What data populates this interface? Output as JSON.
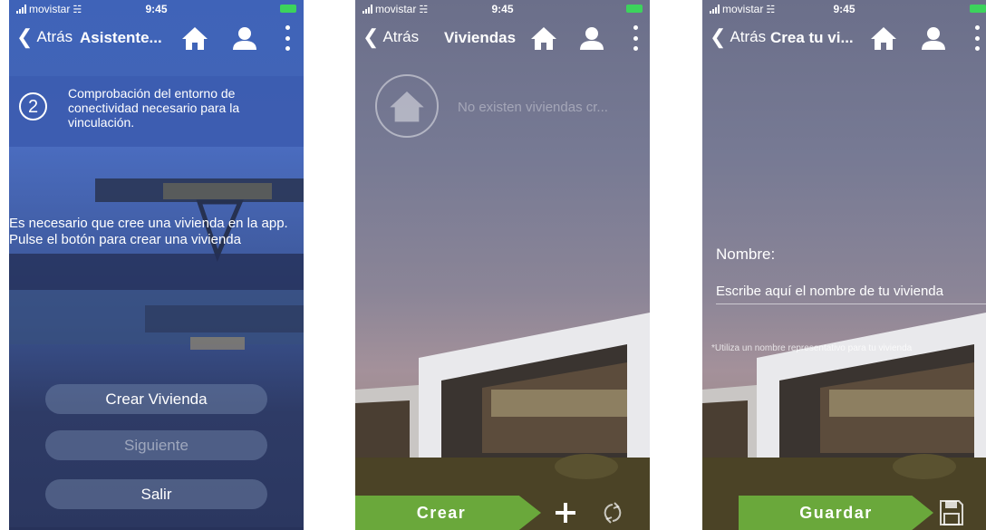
{
  "status_bar": {
    "carrier": "movistar",
    "time": "9:45"
  },
  "screen1": {
    "back_label": "Atrás",
    "title": "Asistente...",
    "step_number": "2",
    "step_text": "Comprobación del entorno de conectividad necesario para la vinculación.",
    "message": "Es necesario que cree una vivienda en la app. Pulse el botón para crear una vivienda",
    "buttons": {
      "create": "Crear Vivienda",
      "next": "Siguiente",
      "exit": "Salir"
    },
    "icons": [
      "home-icon",
      "user-icon",
      "more-vertical-icon"
    ]
  },
  "screen2": {
    "back_label": "Atrás",
    "title": "Viviendas",
    "empty_text": "No existen viviendas cr...",
    "create_button": "Crear",
    "icons": [
      "home-icon",
      "user-icon",
      "more-vertical-icon",
      "plus-icon",
      "refresh-icon"
    ]
  },
  "screen3": {
    "back_label": "Atrás",
    "title": "Crea tu vi...",
    "name_label": "Nombre:",
    "name_placeholder": "Escribe aquí el nombre de tu vivienda",
    "hint": "*Utiliza un nombre representativo para tu vivienda",
    "save_button": "Guardar",
    "icons": [
      "home-icon",
      "user-icon",
      "more-vertical-icon",
      "save-icon"
    ]
  },
  "colors": {
    "accent_green": "#6aa83b",
    "screen1_blue": "#3f63b8",
    "battery_green": "#3cd35c"
  }
}
